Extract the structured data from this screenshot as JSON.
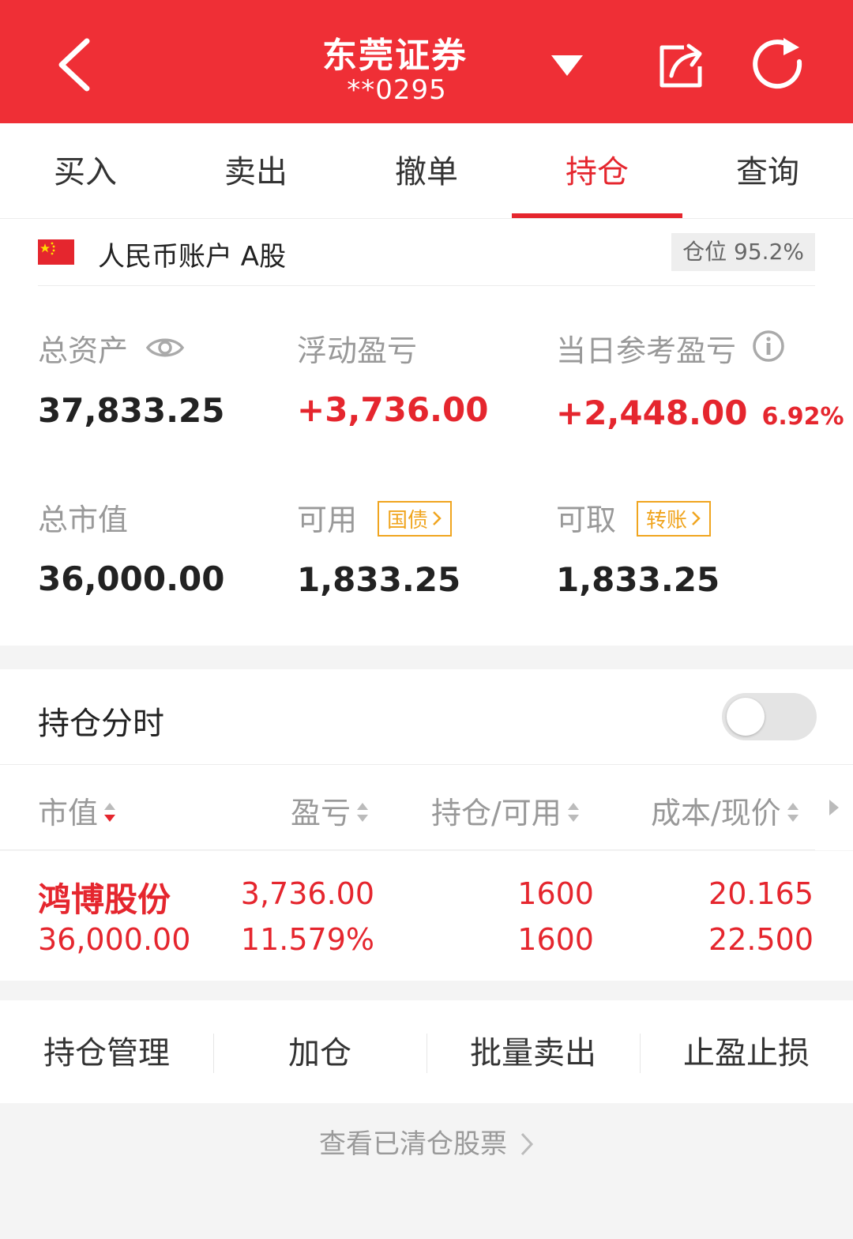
{
  "header": {
    "title": "东莞证券",
    "account_masked": "**0295",
    "colors": {
      "background": "#ef2f36",
      "text": "#ffffff"
    },
    "icons": [
      "back-icon",
      "dropdown-icon",
      "share-icon",
      "refresh-icon"
    ]
  },
  "tabs": [
    {
      "label": "买入",
      "active": false
    },
    {
      "label": "卖出",
      "active": false
    },
    {
      "label": "撤单",
      "active": false
    },
    {
      "label": "持仓",
      "active": true
    },
    {
      "label": "查询",
      "active": false
    }
  ],
  "account": {
    "label": "人民币账户 A股",
    "position_ratio": "仓位 95.2%",
    "flag_icon": "china-flag-icon"
  },
  "summary": {
    "total_assets": {
      "label": "总资产",
      "value": "37,833.25"
    },
    "floating_pnl": {
      "label": "浮动盈亏",
      "value": "+3,736.00"
    },
    "daily_pnl": {
      "label": "当日参考盈亏",
      "value": "+2,448.00",
      "percent": "6.92%"
    },
    "market_value": {
      "label": "总市值",
      "value": "36,000.00"
    },
    "available": {
      "label": "可用",
      "tag": "国债",
      "value": "1,833.25"
    },
    "withdrawable": {
      "label": "可取",
      "tag": "转账",
      "value": "1,833.25"
    }
  },
  "split": {
    "label": "持仓分时",
    "enabled": false
  },
  "table": {
    "headers": [
      "市值",
      "盈亏",
      "持仓/可用",
      "成本/现价"
    ],
    "rows": [
      {
        "name": "鸿博股份",
        "market_value": "36,000.00",
        "pnl": "3,736.00",
        "pnl_pct": "11.579%",
        "position": "1600",
        "available": "1600",
        "cost": "20.165",
        "price": "22.500"
      }
    ]
  },
  "actions": [
    "持仓管理",
    "加仓",
    "批量卖出",
    "止盈止损"
  ],
  "cleared_link": "查看已清仓股票",
  "colors": {
    "accent_red": "#e5262e",
    "tag_orange": "#f0a51f",
    "muted": "#999999"
  }
}
